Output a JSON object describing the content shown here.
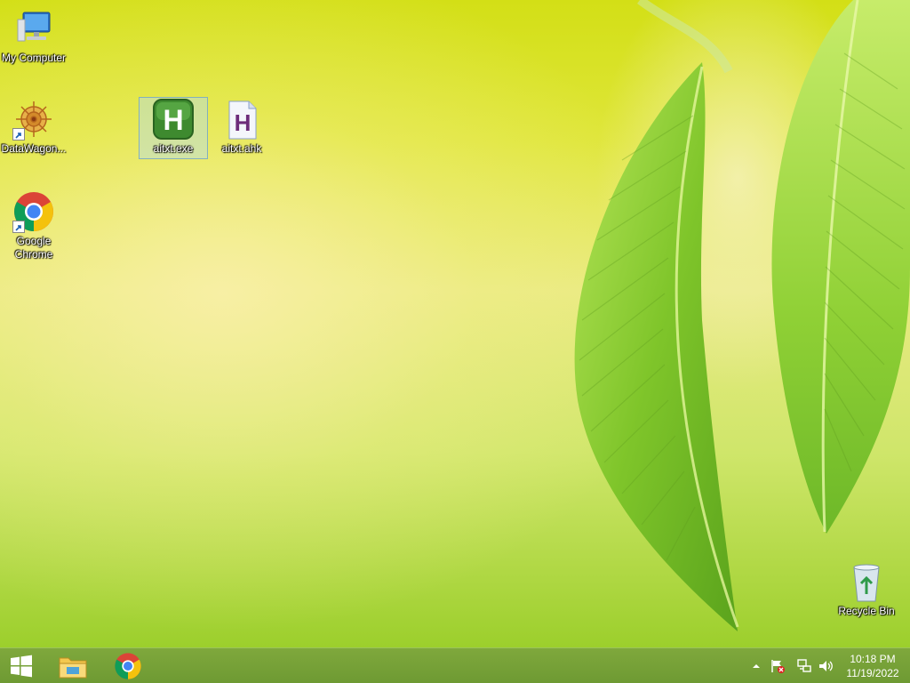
{
  "desktop": {
    "icons": [
      {
        "label": "My Computer",
        "icon": "computer-icon"
      },
      {
        "label": "DataWagon...",
        "icon": "datawagon-icon"
      },
      {
        "label": "Google Chrome",
        "icon": "chrome-icon"
      },
      {
        "label": "aitxt.exe",
        "icon": "autohotkey-exe-icon",
        "selected": true
      },
      {
        "label": "aitxt.ahk",
        "icon": "ahk-script-icon"
      },
      {
        "label": "Recycle Bin",
        "icon": "recycle-bin-icon"
      }
    ]
  },
  "taskbar": {
    "start": {
      "icon": "windows-logo-icon"
    },
    "pinned": [
      {
        "name": "File Explorer",
        "icon": "file-explorer-icon"
      },
      {
        "name": "Google Chrome",
        "icon": "chrome-icon"
      }
    ],
    "tray": {
      "icons": [
        "show-hidden-icons-chevron",
        "action-center-flag-icon",
        "network-icon",
        "volume-icon"
      ]
    },
    "clock": {
      "time": "10:18 PM",
      "date": "11/19/2022"
    }
  },
  "colors": {
    "taskbar": "#76a338",
    "wallpaper_top": "#d3df16",
    "wallpaper_bottom": "#9ccf2c"
  }
}
